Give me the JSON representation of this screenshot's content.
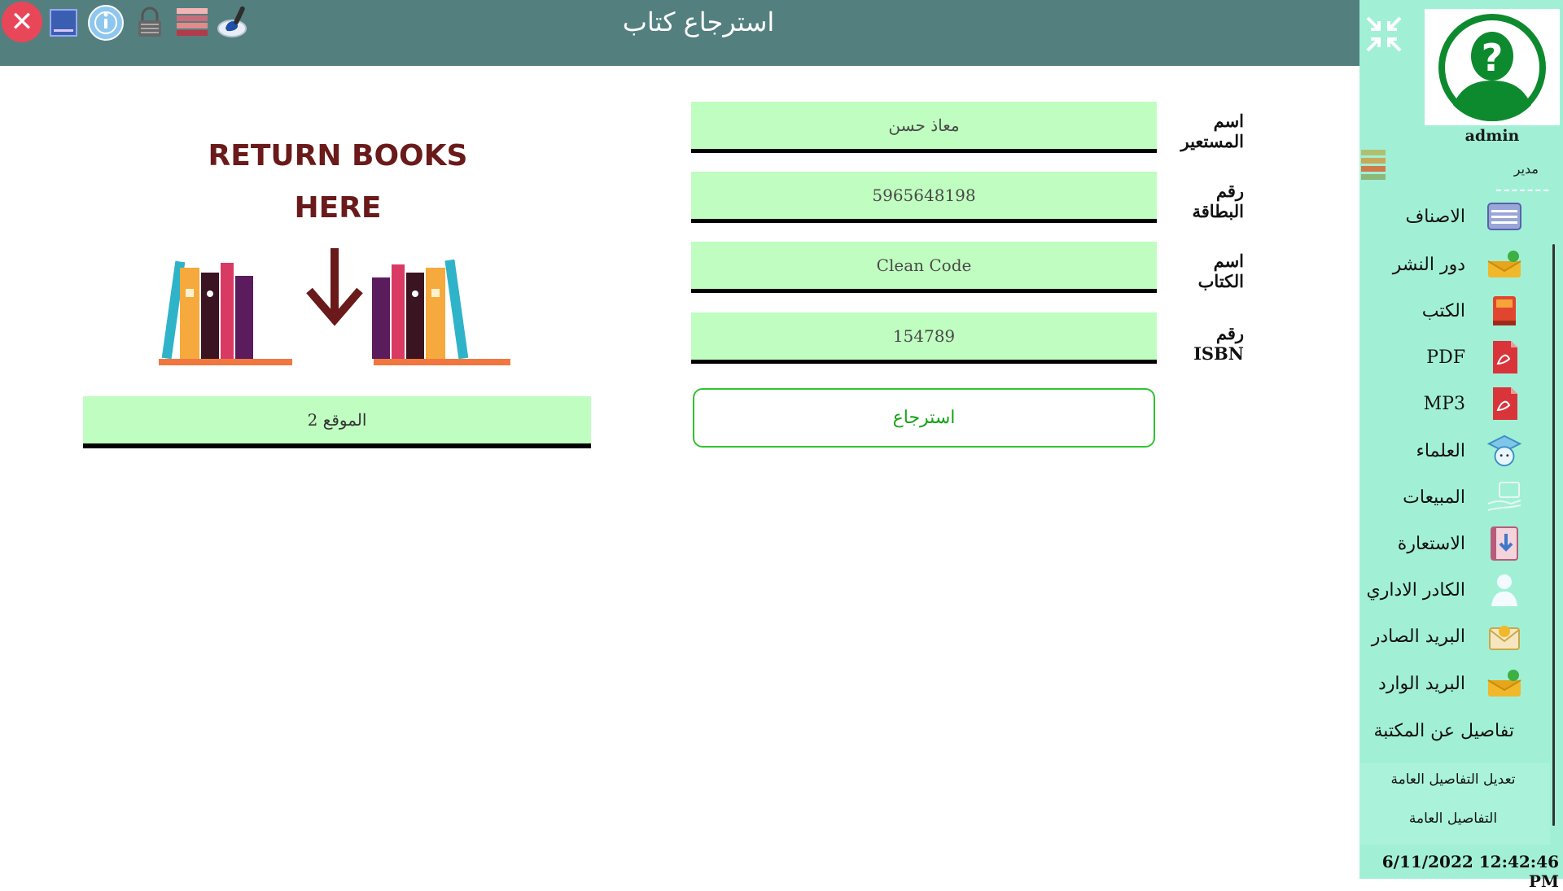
{
  "window": {
    "title": "استرجاع كتاب"
  },
  "toolbar": {
    "icons": [
      "close-icon",
      "minimize-icon",
      "info-icon",
      "lock-icon",
      "theme-icon",
      "paint-icon"
    ]
  },
  "user": {
    "name": "admin",
    "role": "مدير"
  },
  "sidebar": {
    "items": [
      {
        "label": "الاصناف",
        "icon": "categories-icon"
      },
      {
        "label": "دور النشر",
        "icon": "publishers-icon"
      },
      {
        "label": "الكتب",
        "icon": "books-icon"
      },
      {
        "label": "PDF",
        "icon": "pdf-icon"
      },
      {
        "label": "MP3",
        "icon": "mp3-icon"
      },
      {
        "label": "العلماء",
        "icon": "scholars-icon"
      },
      {
        "label": "المبيعات",
        "icon": "sales-icon"
      },
      {
        "label": "الاستعارة",
        "icon": "borrowing-icon"
      },
      {
        "label": "الكادر الاداري",
        "icon": "staff-icon"
      },
      {
        "label": "البريد الصادر",
        "icon": "outbox-icon"
      },
      {
        "label": "البريد الوارد",
        "icon": "inbox-icon"
      },
      {
        "label": "تفاصيل عن المكتبة",
        "icon": ""
      }
    ],
    "sub_items": [
      "تعديل التفاصيل العامة",
      "التفاصيل العامة"
    ]
  },
  "datetime": "6/11/2022 12:42:46 PM",
  "form": {
    "borrower_name": {
      "label": "اسم المستعير",
      "value": "معاذ حسن"
    },
    "card_number": {
      "label": "رقم البطاقة",
      "value": "5965648198"
    },
    "book_name": {
      "label": "اسم الكتاب",
      "value": "Clean Code"
    },
    "isbn": {
      "label": "رقم ISBN",
      "value": "154789"
    },
    "return_button": "استرجاع"
  },
  "poster": {
    "line1": "RETURN BOOKS",
    "line2": "HERE"
  },
  "location": "الموقع 2",
  "colors": {
    "topbar": "#547f7f",
    "sidebar": "#a1f0d6",
    "field": "#c0fdc0",
    "accent": "#2fc42f",
    "poster_text": "#6a1a1a"
  }
}
